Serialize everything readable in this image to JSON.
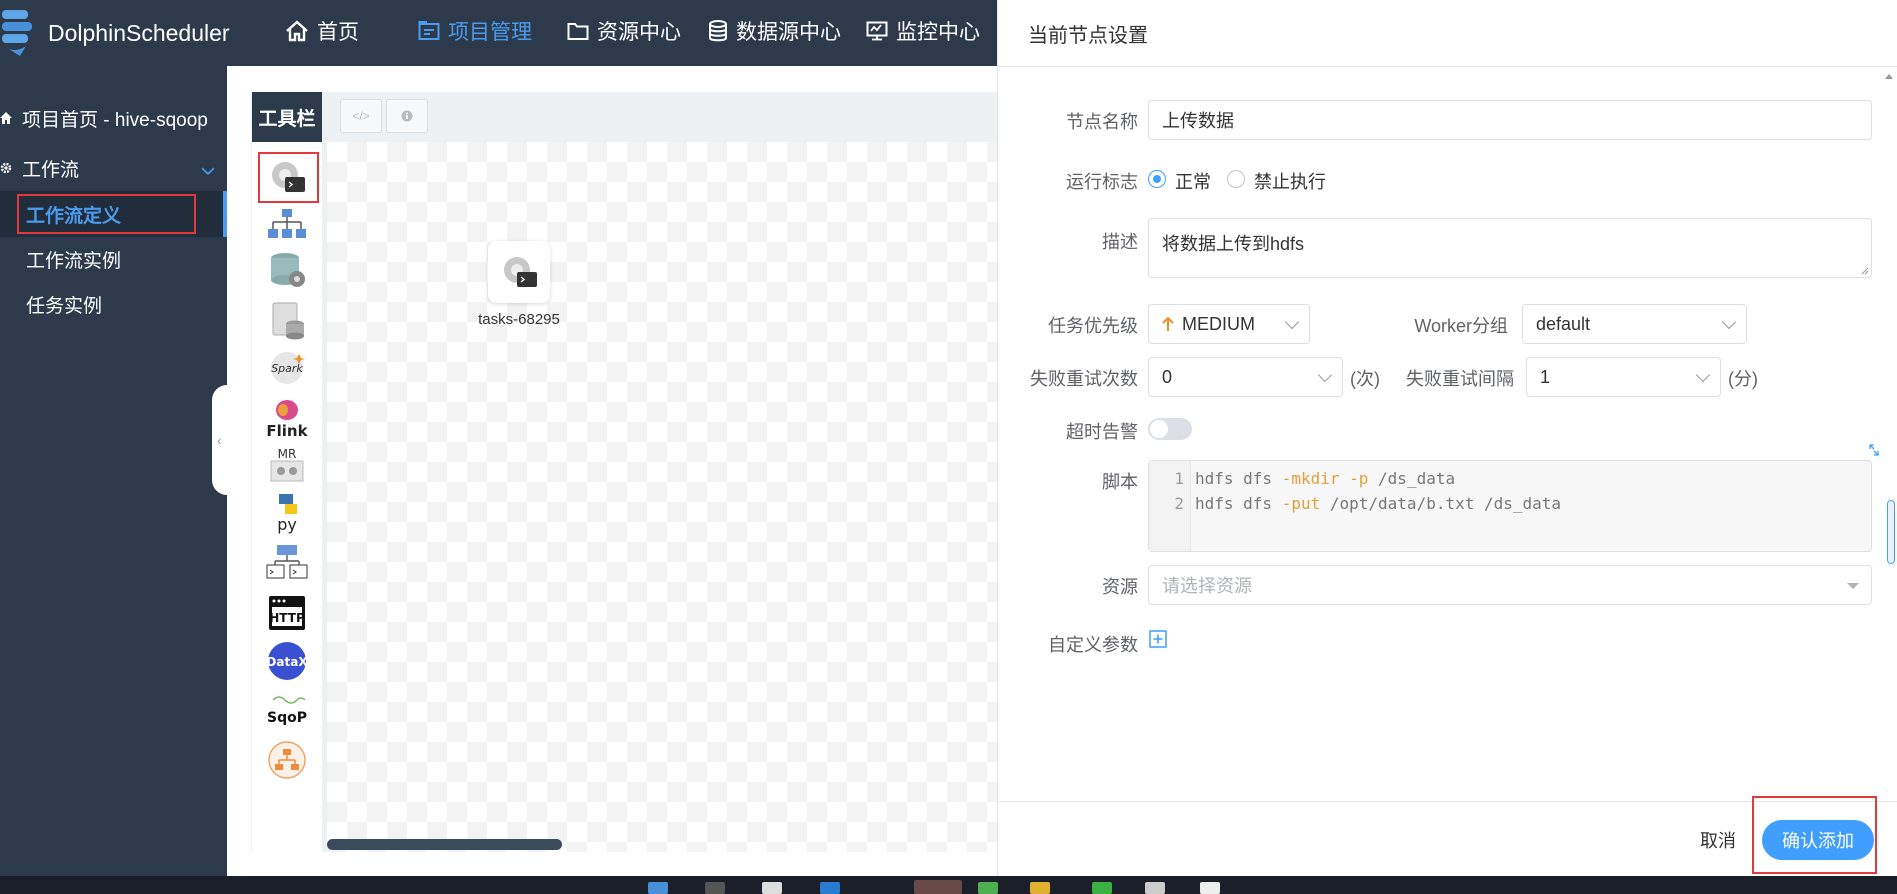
{
  "app": {
    "brand": "DolphinScheduler"
  },
  "nav": {
    "items": [
      {
        "label": "首页",
        "icon": "home-icon",
        "active": false
      },
      {
        "label": "项目管理",
        "icon": "project-icon",
        "active": true
      },
      {
        "label": "资源中心",
        "icon": "folder-icon",
        "active": false
      },
      {
        "label": "数据源中心",
        "icon": "database-icon",
        "active": false
      },
      {
        "label": "监控中心",
        "icon": "monitor-icon",
        "active": false
      }
    ]
  },
  "sidebar": {
    "project_home": "项目首页 - hive-sqoop",
    "workflow_group": "工作流",
    "items": [
      {
        "label": "工作流定义",
        "active": true
      },
      {
        "label": "工作流实例",
        "active": false
      },
      {
        "label": "任务实例",
        "active": false
      }
    ]
  },
  "canvas": {
    "toolbar_label": "工具栏",
    "tools": [
      "shell-icon",
      "sub-process-icon",
      "procedure-icon",
      "sql-icon",
      "spark-icon",
      "flink-icon",
      "mr-icon",
      "python-icon",
      "dependent-icon",
      "http-icon",
      "datax-icon",
      "sqoop-icon",
      "conditions-icon"
    ],
    "tool_labels": {
      "flink": "Flink",
      "mr": "MR",
      "http": "HTTP",
      "datax": "DataX",
      "sqoop": "SqoP",
      "python": "py",
      "spark": "Spark"
    },
    "node_label": "tasks-68295"
  },
  "drawer": {
    "title": "当前节点设置",
    "node_name_label": "节点名称",
    "node_name_value": "上传数据",
    "run_flag_label": "运行标志",
    "run_flag_options": [
      "正常",
      "禁止执行"
    ],
    "run_flag_selected": "正常",
    "desc_label": "描述",
    "desc_value": "将数据上传到hdfs",
    "priority_label": "任务优先级",
    "priority_value": "MEDIUM",
    "worker_group_label": "Worker分组",
    "worker_group_value": "default",
    "retry_times_label": "失败重试次数",
    "retry_times_value": "0",
    "retry_times_unit": "(次)",
    "retry_interval_label": "失败重试间隔",
    "retry_interval_value": "1",
    "retry_interval_unit": "(分)",
    "timeout_label": "超时告警",
    "timeout_enabled": false,
    "script_label": "脚本",
    "script_lines": [
      {
        "num": "1",
        "pre": "hdfs dfs ",
        "kw": "-mkdir -p",
        "post": " /ds_data"
      },
      {
        "num": "2",
        "pre": "hdfs dfs ",
        "kw": "-put",
        "post": " /opt/data/b.txt /ds_data"
      }
    ],
    "resource_label": "资源",
    "resource_placeholder": "请选择资源",
    "custom_params_label": "自定义参数",
    "cancel_label": "取消",
    "confirm_label": "确认添加"
  },
  "colors": {
    "nav_bg": "#2c3a4c",
    "accent": "#409eff",
    "highlight": "#e4393c",
    "priority_arrow": "#f08a24"
  }
}
